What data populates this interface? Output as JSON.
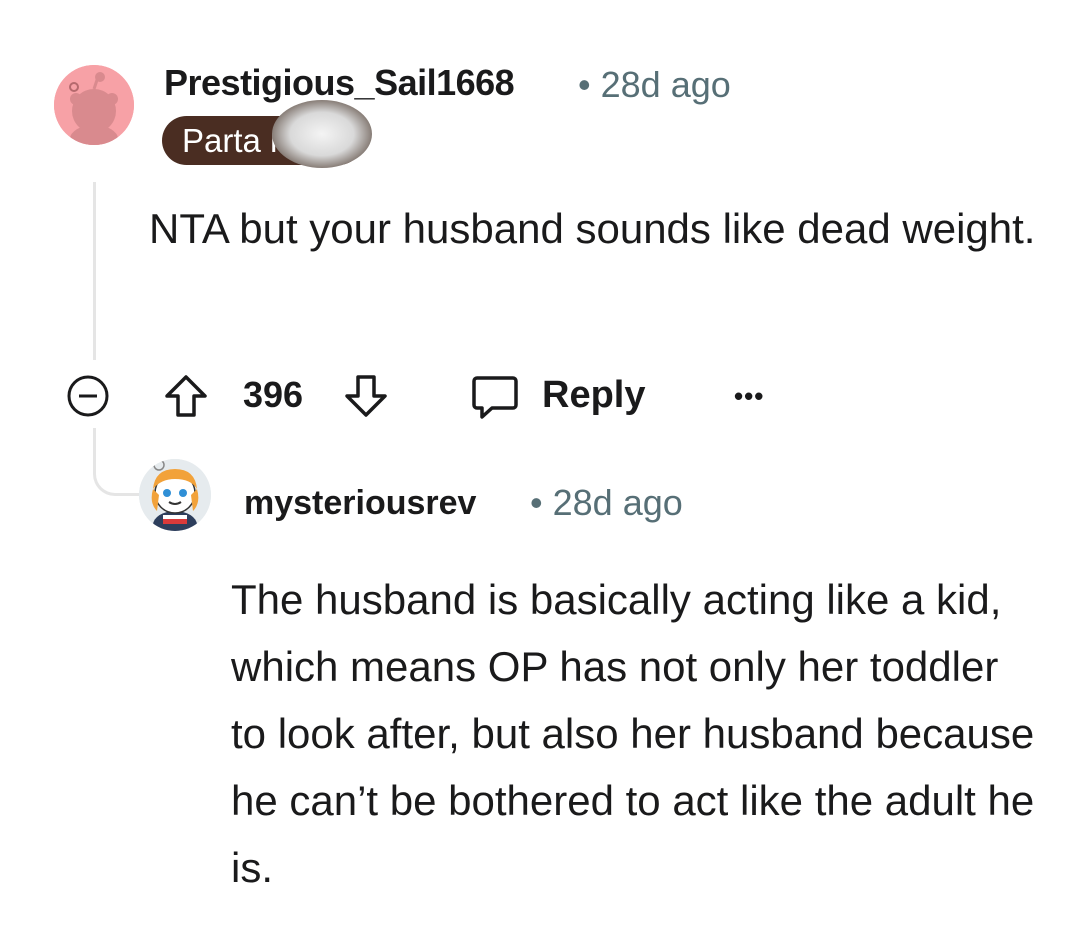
{
  "comment1": {
    "username": "Prestigious_Sail1668",
    "separator": "•",
    "time": "28d ago",
    "flair": "Parta      nt [1]",
    "body": "NTA but your husband sounds like dead weight.",
    "avatar_icon": "snoo-avatar-pink-icon",
    "accent_color": "#f7a1a6",
    "actions": {
      "collapse_icon": "collapse-minus-icon",
      "upvote_icon": "upvote-arrow-icon",
      "score": "396",
      "downvote_icon": "downvote-arrow-icon",
      "reply_icon": "comment-bubble-icon",
      "reply_label": "Reply",
      "more_label": "•••"
    }
  },
  "comment2": {
    "username": "mysteriousrev",
    "separator": "•",
    "time": "28d ago",
    "body": "The husband is basically acting like a kid, which means OP has not only her toddler to look after, but also her husband because he can’t be bothered to act like the adult he is.",
    "avatar_icon": "snoo-avatar-orange-hair-icon"
  },
  "colors": {
    "text": "#1a1a1b",
    "meta": "#576f76",
    "flair_bg": "#4a2d22",
    "thread_line": "#e5e5e5"
  }
}
